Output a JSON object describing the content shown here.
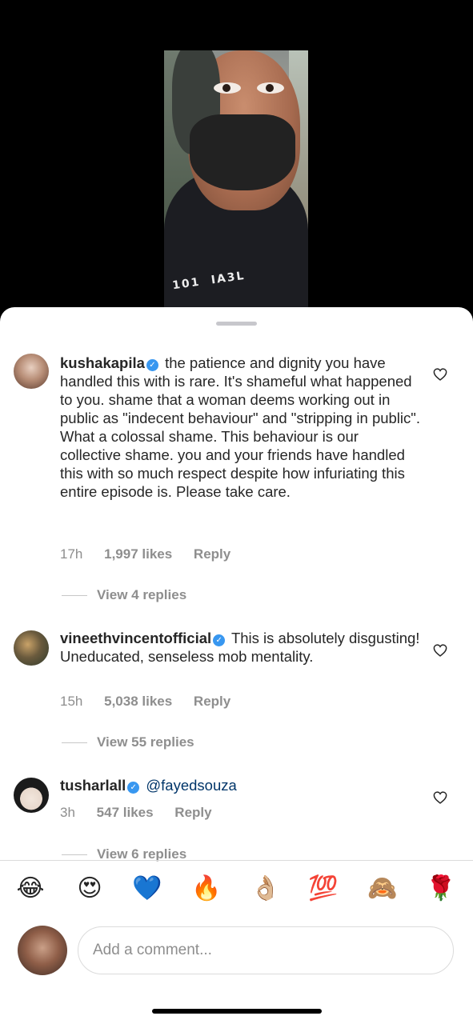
{
  "comments": [
    {
      "username": "kushakapila",
      "text": "the patience and dignity you have handled this with is rare. It's shameful what happened to you. shame that a woman deems working out in public as \"indecent behaviour\" and \"stripping in public\". What a colossal shame.  This behaviour is our collective shame. you and your friends have handled this with so much respect despite how infuriating this entire episode is. Please take care.",
      "time": "17h",
      "likes": "1,997 likes",
      "reply": "Reply",
      "view_replies": "View 4 replies"
    },
    {
      "username": "vineethvincentofficial",
      "text": "This is absolutely disgusting! Uneducated, senseless mob mentality.",
      "time": "15h",
      "likes": "5,038 likes",
      "reply": "Reply",
      "view_replies": "View 55 replies"
    },
    {
      "username": "tusharlall",
      "text": "@fayedsouza",
      "time": "3h",
      "likes": "547 likes",
      "reply": "Reply",
      "view_replies": "View 6 replies"
    }
  ],
  "emoji_bar": [
    "😂",
    "😍",
    "💙",
    "🔥",
    "👌🏼",
    "💯",
    "🙈",
    "🌹"
  ],
  "composer": {
    "placeholder": "Add a comment..."
  },
  "video": {
    "hoodie_text": "101  IA3L"
  }
}
